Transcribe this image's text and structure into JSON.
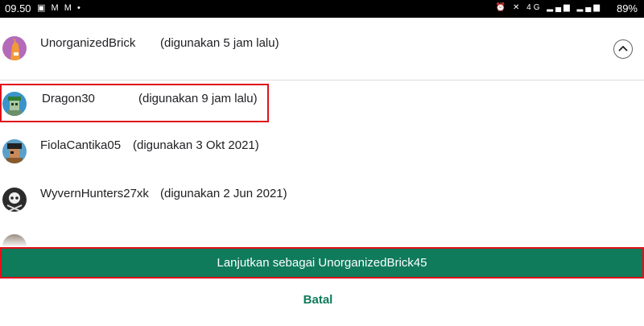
{
  "status_bar": {
    "time": "09.50",
    "battery": "89%",
    "left_icons": [
      "image-icon",
      "mail-icon",
      "mail-icon",
      "dot-icon"
    ],
    "right_icons": [
      "alarm-icon",
      "mute-icon",
      "4g-icon",
      "signal-icon",
      "signal-icon",
      "battery-icon"
    ]
  },
  "accounts": [
    {
      "name": "UnorganizedBrick",
      "used": "(digunakan 5 jam lalu)",
      "avatar": "horse-avatar"
    },
    {
      "name": "Dragon30",
      "used": "(digunakan 9 jam lalu)",
      "avatar": "robot-avatar"
    },
    {
      "name": "FiolaCantika05",
      "used": "(digunakan 3 Okt 2021)",
      "avatar": "pirate-avatar"
    },
    {
      "name": "WyvernHunters27xk",
      "used": "(digunakan 2 Jun 2021)",
      "avatar": "skull-avatar"
    }
  ],
  "actions": {
    "continue_label": "Lanjutkan sebagai UnorganizedBrick45",
    "cancel_label": "Batal"
  },
  "colors": {
    "primary": "#0f7b5a",
    "highlight_border": "#e0101a"
  }
}
